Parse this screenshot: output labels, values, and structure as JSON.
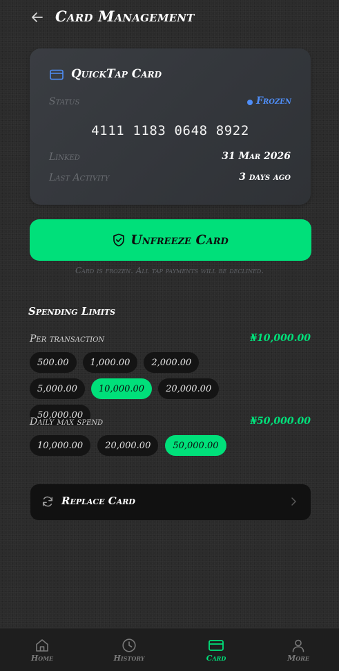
{
  "header": {
    "title": "Card Management"
  },
  "card": {
    "name": "QuickTap Card",
    "status_label": "Status",
    "status_value": "Frozen",
    "number": "4111 1183 0648 8922",
    "linked_label": "Linked",
    "linked_value": "31 Mar 2026",
    "activity_label": "Last Activity",
    "activity_value": "3 days ago"
  },
  "actions": {
    "unfreeze_label": "Unfreeze Card",
    "frozen_note": "Card is frozen. All tap payments will be declined."
  },
  "limits": {
    "title": "Spending Limits",
    "per_transaction": {
      "label": "Per transaction",
      "value": "₦10,000.00",
      "options": [
        "500.00",
        "1,000.00",
        "2,000.00",
        "5,000.00",
        "10,000.00",
        "20,000.00",
        "50,000.00"
      ],
      "selected": "10,000.00"
    },
    "daily": {
      "label": "Daily max spend",
      "value": "₦50,000.00",
      "options": [
        "10,000.00",
        "20,000.00",
        "50,000.00"
      ],
      "selected": "50,000.00"
    }
  },
  "replace": {
    "label": "Replace Card"
  },
  "nav": {
    "items": [
      {
        "label": "Home",
        "icon": "home-icon"
      },
      {
        "label": "History",
        "icon": "clock-icon"
      },
      {
        "label": "Card",
        "icon": "card-icon",
        "active": true
      },
      {
        "label": "More",
        "icon": "user-icon"
      }
    ]
  },
  "colors": {
    "accent": "#00e07a",
    "frozen": "#4f8ef7",
    "background": "#2b2b2b",
    "card_panel": "#36393e"
  }
}
